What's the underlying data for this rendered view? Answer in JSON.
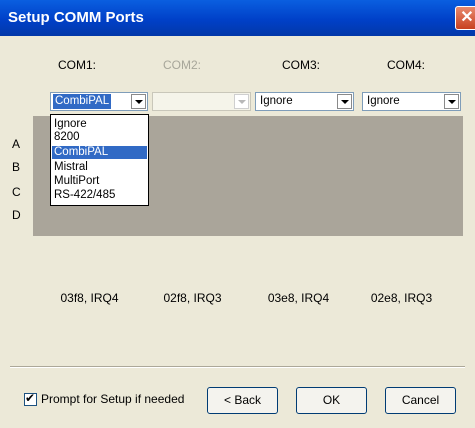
{
  "window": {
    "title": "Setup COMM Ports"
  },
  "ports": [
    {
      "label": "COM1:",
      "value": "CombiPAL",
      "io": "03f8, IRQ4"
    },
    {
      "label": "COM2:",
      "value": "",
      "io": "02f8, IRQ3"
    },
    {
      "label": "COM3:",
      "value": "Ignore",
      "io": "03e8, IRQ4"
    },
    {
      "label": "COM4:",
      "value": "Ignore",
      "io": "02e8, IRQ3"
    }
  ],
  "rows": [
    "A",
    "B",
    "C",
    "D"
  ],
  "dropdown_options": [
    "Ignore",
    "8200",
    "CombiPAL",
    "Mistral",
    "MultiPort",
    "RS-422/485"
  ],
  "dropdown_selected": "CombiPAL",
  "prompt": {
    "label": "Prompt for Setup if needed",
    "checked": true,
    "check_mark": "✔"
  },
  "buttons": {
    "back": "< Back",
    "ok": "OK",
    "cancel": "Cancel"
  },
  "icons": {
    "close": "✕"
  },
  "colors": {
    "titlebar": "#0040c8",
    "client": "#ece9d8",
    "panel": "#aaa59a",
    "selection": "#316ac5"
  }
}
